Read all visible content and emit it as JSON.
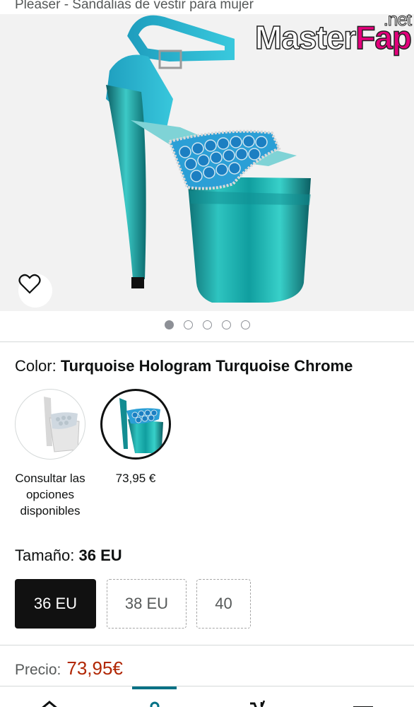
{
  "header": {
    "title": "Pleaser - Sandalias de vestir para mujer"
  },
  "watermark": {
    "text_a": "Master",
    "text_b": "Fap",
    "text_c": ".net"
  },
  "gallery": {
    "image_count": 5,
    "active_index": 0
  },
  "color": {
    "label": "Color:",
    "selected": "Turquoise Hologram Turquoise Chrome",
    "options": [
      {
        "caption": "Consultar las opciones disponibles"
      },
      {
        "caption": "73,95 €"
      }
    ]
  },
  "size": {
    "label": "Tamaño:",
    "selected": "36 EU",
    "options": [
      "36 EU",
      "38 EU",
      "40"
    ]
  },
  "price": {
    "label": "Precio:",
    "amount": "73,95€"
  },
  "colors": {
    "accent": "#007185",
    "price": "#b12704",
    "selected_bg": "#111111"
  }
}
